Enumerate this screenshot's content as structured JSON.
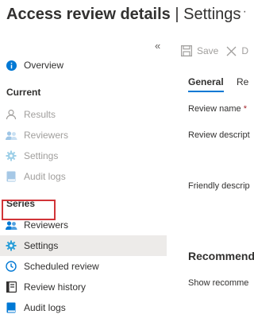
{
  "header": {
    "title": "Access review details",
    "separator": "|",
    "subtitle": "Settings",
    "more": "···"
  },
  "sidebar": {
    "collapse": "«",
    "overview": {
      "label": "Overview",
      "icon": "info-icon"
    },
    "sections": [
      {
        "title": "Current",
        "items": [
          {
            "label": "Results",
            "icon": "person-icon",
            "disabled": true
          },
          {
            "label": "Reviewers",
            "icon": "people-icon",
            "disabled": true
          },
          {
            "label": "Settings",
            "icon": "gear-icon",
            "disabled": true
          },
          {
            "label": "Audit logs",
            "icon": "book-icon",
            "disabled": true
          }
        ]
      },
      {
        "title": "Series",
        "items": [
          {
            "label": "Reviewers",
            "icon": "people-icon",
            "disabled": false
          },
          {
            "label": "Settings",
            "icon": "gear-icon",
            "disabled": false,
            "selected": true
          },
          {
            "label": "Scheduled review",
            "icon": "clock-icon",
            "disabled": false
          },
          {
            "label": "Review history",
            "icon": "history-icon",
            "disabled": false
          },
          {
            "label": "Audit logs",
            "icon": "book-icon",
            "disabled": false
          }
        ]
      }
    ]
  },
  "toolbar": {
    "save_label": "Save",
    "discard_label": "D"
  },
  "tabs": {
    "general": "General",
    "second": "Re"
  },
  "form": {
    "review_name": "Review name",
    "required_mark": "*",
    "review_description": "Review descript",
    "friendly_description": "Friendly descrip"
  },
  "recommendations": {
    "title": "Recommend",
    "show": "Show recomme"
  },
  "colors": {
    "accent": "#0078d4",
    "highlight": "#d13438",
    "selected_bg": "#edebe9",
    "disabled": "#a19f9d"
  }
}
